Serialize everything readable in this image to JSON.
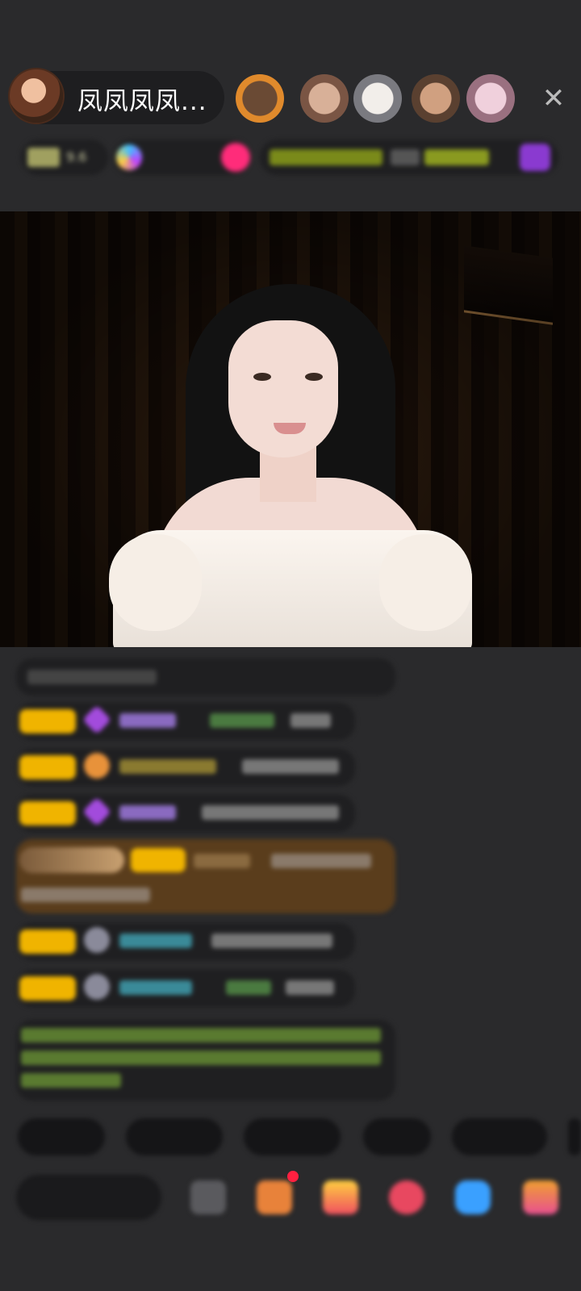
{
  "header": {
    "host_name": "凤凤凤凤...",
    "close_glyph": "✕",
    "viewers": [
      {
        "icon": "viewer-avatar-1-icon",
        "color": "#e08a2c"
      },
      {
        "icon": "viewer-avatar-2-icon",
        "color": "#b07a5a"
      },
      {
        "icon": "viewer-avatar-3-icon",
        "color": "#cfc8c0"
      },
      {
        "icon": "viewer-avatar-4-icon",
        "color": "#8a6a50"
      },
      {
        "icon": "viewer-avatar-5-icon",
        "color": "#d6a6b6"
      }
    ],
    "info": {
      "hot_text": "9.6",
      "rank_text": "",
      "notice_text": "",
      "icons": [
        "hot-icon",
        "rank-icon",
        "fire-icon",
        "gift-icon"
      ]
    }
  },
  "chat": {
    "messages": [
      {
        "type": "system",
        "name": "",
        "text": ""
      },
      {
        "type": "user",
        "badge_color": "#f0b400",
        "gem_color": "#a24bdc",
        "name": "",
        "name_color": "#c7a2ff",
        "text": ""
      },
      {
        "type": "user",
        "badge_color": "#f0b400",
        "gem_color": "#e8923a",
        "name": "",
        "name_color": "#e0c060",
        "text": ""
      },
      {
        "type": "user",
        "badge_color": "#f0b400",
        "gem_color": "#a24bdc",
        "name": "",
        "name_color": "#c7a2ff",
        "text": ""
      },
      {
        "type": "highlight",
        "badge_color": "#f0b400",
        "name": "",
        "name_color": "#e0b060",
        "text": ""
      },
      {
        "type": "user",
        "badge_color": "#f0b400",
        "gem_color": "#8a8a9a",
        "name": "",
        "name_color": "#56c8d8",
        "text": ""
      },
      {
        "type": "user",
        "badge_color": "#f0b400",
        "gem_color": "#8a8a9a",
        "name": "",
        "name_color": "#56c8d8",
        "text": ""
      },
      {
        "type": "notice",
        "text": ""
      }
    ]
  },
  "quick_replies": [
    {
      "label": ""
    },
    {
      "label": ""
    },
    {
      "label": ""
    },
    {
      "label": ""
    },
    {
      "label": ""
    },
    {
      "label": ""
    }
  ],
  "bottom_bar": {
    "say_placeholder": "",
    "icons": [
      {
        "name": "emoji-icon",
        "color": "#5a5a5e"
      },
      {
        "name": "gift-box-icon",
        "color": "#e8823a"
      },
      {
        "name": "treasure-icon",
        "color": "#f05060"
      },
      {
        "name": "heart-chat-icon",
        "color": "#e84860"
      },
      {
        "name": "game-icon",
        "color": "#3aa0ff"
      },
      {
        "name": "more-apps-icon",
        "color": "#e85090"
      }
    ]
  }
}
